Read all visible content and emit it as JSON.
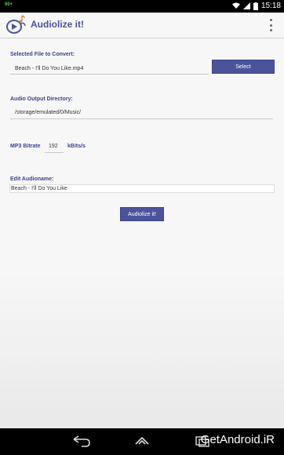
{
  "status_bar": {
    "notification": "90+",
    "time": "15:18"
  },
  "app_bar": {
    "title": "Audiolize it!",
    "icons": [
      "app-logo-icon",
      "overflow-menu-icon"
    ]
  },
  "form": {
    "selected_file": {
      "label": "Selected File to Convert:",
      "value": "Beach - I'll Do You Like.mp4",
      "button_label": "Select"
    },
    "output_dir": {
      "label": "Audio Output Directory:",
      "value": "/storage/emulated/0/Music/"
    },
    "bitrate": {
      "label": "MP3 Bitrate",
      "value": "192",
      "unit": "kBits/s"
    },
    "audioname": {
      "label": "Edit Audioname:",
      "value": "Beach - I'll Do You Like"
    },
    "submit_label": "Audiolize it!"
  },
  "watermark": "GetAndroid.iR",
  "colors": {
    "accent": "#4b549a",
    "label": "#3a4490",
    "background": "#f7f7f7"
  }
}
